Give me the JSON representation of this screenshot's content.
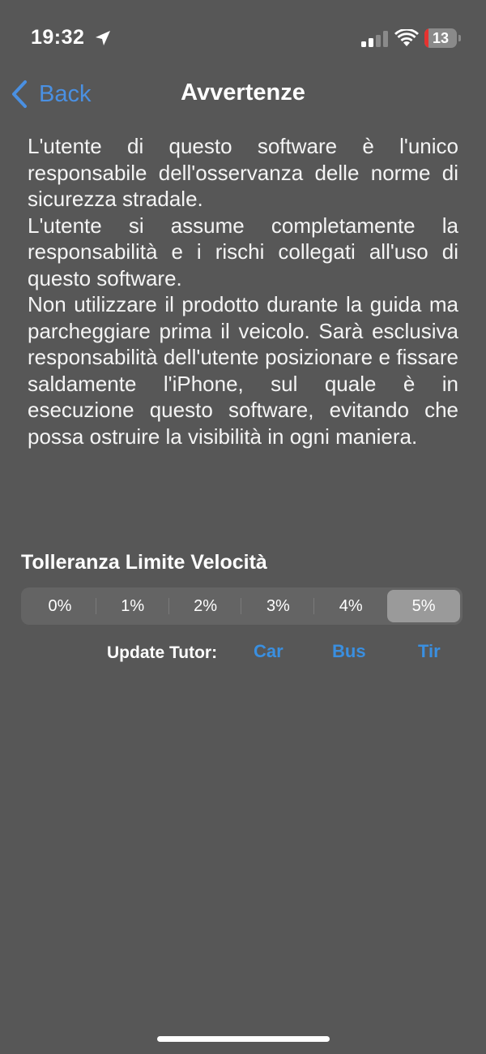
{
  "status_bar": {
    "time": "19:32",
    "battery": "13",
    "battery_level": 0.13,
    "icons": [
      "location-arrow-icon",
      "signal-bars-icon",
      "wifi-icon",
      "battery-icon"
    ],
    "signal_bars_active": 2
  },
  "nav": {
    "back_label": "Back",
    "title": "Avvertenze",
    "accent_color": "#4a90e2"
  },
  "disclaimer": {
    "paragraphs": [
      "L'utente di questo software è l'unico responsabile dell'osservanza delle norme di sicurezza stradale.",
      "L'utente si assume completamente la responsabilità e i rischi collegati all'uso di questo software.",
      "Non utilizzare il prodotto durante la guida ma parcheggiare prima il veicolo. Sarà esclusiva responsabilità dell'utente posizionare e fissare saldamente l'iPhone, sul quale è in esecuzione questo software, evitando che possa ostruire la visibilità in ogni maniera."
    ]
  },
  "tolerance": {
    "title": "Tolleranza Limite Velocità",
    "options": [
      "0%",
      "1%",
      "2%",
      "3%",
      "4%",
      "5%"
    ],
    "selected": "5%"
  },
  "update_tutor": {
    "label": "Update Tutor:",
    "links": [
      "Car",
      "Bus",
      "Tir"
    ],
    "link_color": "#3a8fe0"
  },
  "colors": {
    "background": "#575757",
    "segment_selected": "#9a9a9a",
    "battery_low": "#e5322f"
  }
}
